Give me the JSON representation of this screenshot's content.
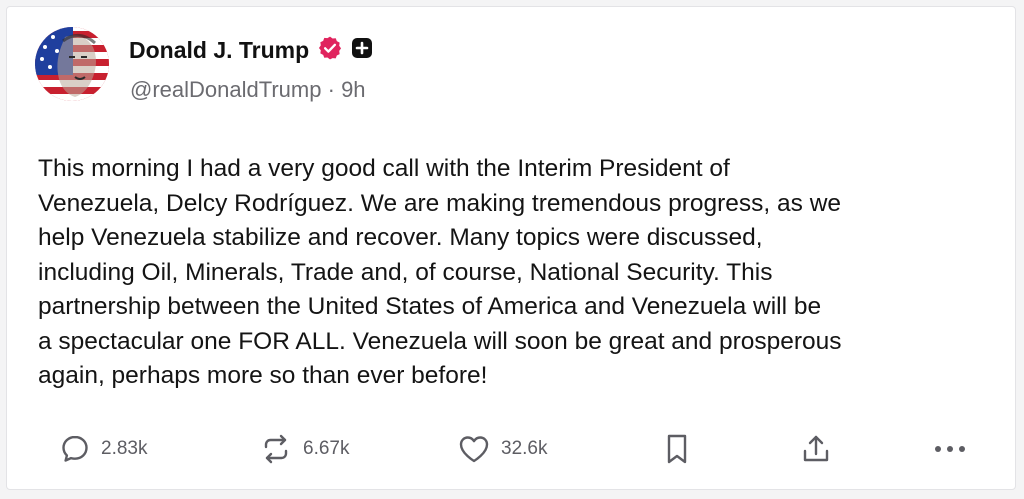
{
  "post": {
    "author": {
      "display_name": "Donald J. Trump",
      "handle": "@realDonaldTrump",
      "separator": "·",
      "time": "9h",
      "verified_badge": "verified-badge-icon",
      "extra_badge": "plus-badge-icon"
    },
    "text": "This morning I had a very good call with the Interim President of\nVenezuela, Delcy Rodríguez. We are making tremendous progress, as we\nhelp Venezuela stabilize and recover. Many topics were discussed,\nincluding Oil, Minerals, Trade and, of course, National Security. This\npartnership between the United States of America and Venezuela will be\na spectacular one FOR ALL. Venezuela will soon be great and prosperous\nagain, perhaps more so than ever before!",
    "actions": {
      "replies": "2.83k",
      "reposts": "6.67k",
      "likes": "32.6k"
    }
  },
  "colors": {
    "verified_badge": "#e0245e",
    "text": "#141414",
    "muted": "#6b6b70",
    "icon": "#5d5d63"
  }
}
